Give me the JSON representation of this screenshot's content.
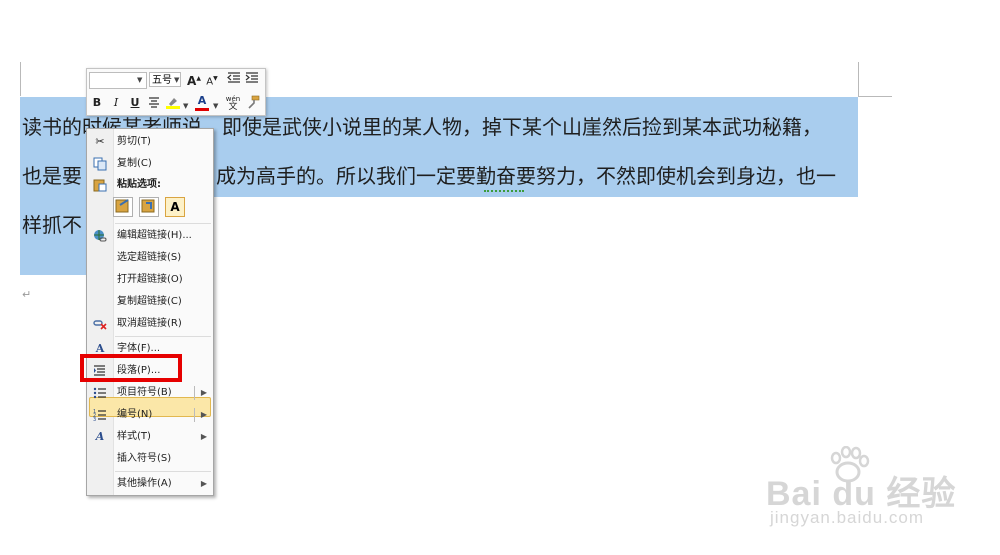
{
  "document": {
    "lines": [
      "读书的时候某老师说，即使是武侠小说里的某人物，掉下某个山崖然后捡到某本武功秘籍，",
      "也是要",
      "成为高手的。所以我们一定要勤奋要努力，不然即使机会到身边，也一",
      "样抓不"
    ],
    "paragraph_mark": "↵"
  },
  "mini_toolbar": {
    "font_name": "",
    "font_size": "五号",
    "grow_font": "A",
    "shrink_font": "A",
    "bold": "B",
    "italic": "I",
    "underline": "U",
    "font_color_glyph": "A",
    "phonetic": "wén",
    "highlight_color": "#ffff00",
    "font_color": "#e00000"
  },
  "context_menu": {
    "items": [
      {
        "label": "剪切(T)",
        "icon": "scissors-icon"
      },
      {
        "label": "复制(C)",
        "icon": "copy-icon"
      },
      {
        "label": "粘贴选项:",
        "icon": "paste-icon"
      },
      {
        "label": "编辑超链接(H)...",
        "icon": "globe-link-icon"
      },
      {
        "label": "选定超链接(S)"
      },
      {
        "label": "打开超链接(O)"
      },
      {
        "label": "复制超链接(C)"
      },
      {
        "label": "取消超链接(R)",
        "icon": "remove-link-icon"
      },
      {
        "label": "字体(F)...",
        "icon": "font-icon"
      },
      {
        "label": "段落(P)...",
        "icon": "paragraph-icon"
      },
      {
        "label": "项目符号(B)",
        "icon": "bullets-icon"
      },
      {
        "label": "编号(N)",
        "icon": "numbering-icon"
      },
      {
        "label": "样式(T)",
        "icon": "styles-icon"
      },
      {
        "label": "插入符号(S)"
      },
      {
        "label": "其他操作(A)"
      }
    ],
    "paste_option_text": "A"
  },
  "watermark": {
    "brand": "Bai du 经验",
    "url": "jingyan.baidu.com"
  },
  "colors": {
    "selection": "#a9cdee",
    "menu_highlight": "#fbe7a8",
    "annotation_box": "#e60000"
  }
}
